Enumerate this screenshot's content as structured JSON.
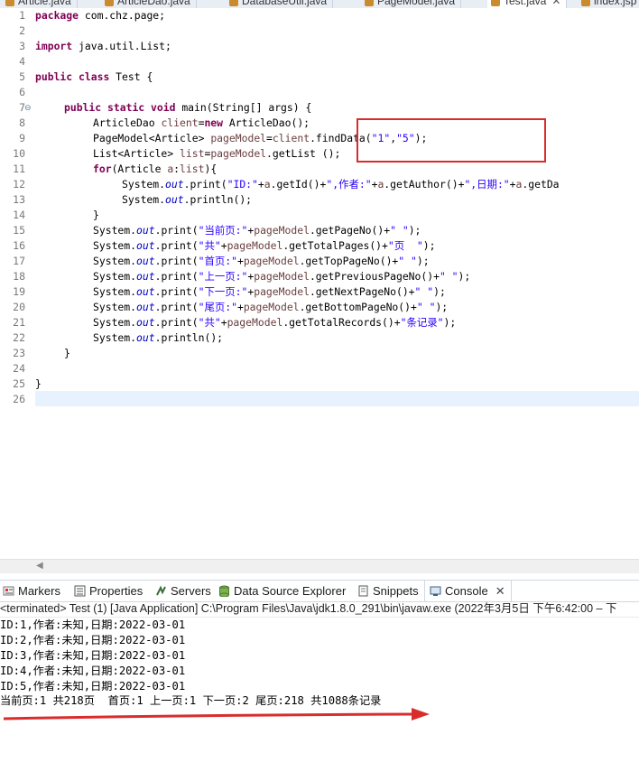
{
  "editor_tabs": [
    {
      "label": "Article.java",
      "active": false
    },
    {
      "label": "ArticleDao.java",
      "active": false
    },
    {
      "label": "DatabaseUtil.java",
      "active": false
    },
    {
      "label": "PageModel.java",
      "active": false
    },
    {
      "label": "Test.java",
      "active": true
    },
    {
      "label": "index.jsp",
      "active": false
    }
  ],
  "line_numbers": [
    "1",
    "2",
    "3",
    "4",
    "5",
    "6",
    "7",
    "8",
    "9",
    "10",
    "11",
    "12",
    "13",
    "14",
    "15",
    "16",
    "17",
    "18",
    "19",
    "20",
    "21",
    "22",
    "23",
    "24",
    "25",
    "26"
  ],
  "code": {
    "l1_kw": "package",
    "l1_rest": " com.chz.page;",
    "l3_kw": "import",
    "l3_rest": " java.util.List;",
    "l5_kw1": "public",
    "l5_kw2": "class",
    "l5_rest": " Test {",
    "l7_kw1": "public",
    "l7_kw2": "static",
    "l7_kw3": "void",
    "l7_rest": " main(String[] args) {",
    "l8_a": "ArticleDao ",
    "l8_var": "client",
    "l8_b": "=",
    "l8_kw": "new",
    "l8_c": " ArticleDao();",
    "l9_a": "PageModel<Article> ",
    "l9_var": "pageModel",
    "l9_b": "=",
    "l9_var2": "client",
    "l9_c": ".findData(",
    "l9_s1": "\"1\"",
    "l9_d": ",",
    "l9_s2": "\"5\"",
    "l9_e": ");",
    "l10_a": "List<Article> ",
    "l10_var": "list",
    "l10_b": "=",
    "l10_var2": "pageModel",
    "l10_c": ".getList ();",
    "l11_kw": "for",
    "l11_a": "(Article ",
    "l11_var": "a",
    "l11_b": ":",
    "l11_var2": "list",
    "l11_c": "){",
    "l12_a": "System.",
    "l12_fld": "out",
    "l12_b": ".print(",
    "l12_s1": "\"ID:\"",
    "l12_c": "+",
    "l12_v1": "a",
    "l12_d": ".getId()+",
    "l12_s2": "\",作者:\"",
    "l12_e": "+",
    "l12_v2": "a",
    "l12_f": ".getAuthor()+",
    "l12_s3": "\",日期:\"",
    "l12_g": "+",
    "l12_v3": "a",
    "l12_h": ".getDa",
    "l13_a": "System.",
    "l13_fld": "out",
    "l13_b": ".println();",
    "l14": "}",
    "l15_a": "System.",
    "l15_fld": "out",
    "l15_b": ".print(",
    "l15_s1": "\"当前页:\"",
    "l15_c": "+",
    "l15_var": "pageModel",
    "l15_d": ".getPageNo()+",
    "l15_s2": "\" \"",
    "l15_e": ");",
    "l16_a": "System.",
    "l16_fld": "out",
    "l16_b": ".print(",
    "l16_s1": "\"共\"",
    "l16_c": "+",
    "l16_var": "pageModel",
    "l16_d": ".getTotalPages()+",
    "l16_s2": "\"页  \"",
    "l16_e": ");",
    "l17_a": "System.",
    "l17_fld": "out",
    "l17_b": ".print(",
    "l17_s1": "\"首页:\"",
    "l17_c": "+",
    "l17_var": "pageModel",
    "l17_d": ".getTopPageNo()+",
    "l17_s2": "\" \"",
    "l17_e": ");",
    "l18_a": "System.",
    "l18_fld": "out",
    "l18_b": ".print(",
    "l18_s1": "\"上一页:\"",
    "l18_c": "+",
    "l18_var": "pageModel",
    "l18_d": ".getPreviousPageNo()+",
    "l18_s2": "\" \"",
    "l18_e": ");",
    "l19_a": "System.",
    "l19_fld": "out",
    "l19_b": ".print(",
    "l19_s1": "\"下一页:\"",
    "l19_c": "+",
    "l19_var": "pageModel",
    "l19_d": ".getNextPageNo()+",
    "l19_s2": "\" \"",
    "l19_e": ");",
    "l20_a": "System.",
    "l20_fld": "out",
    "l20_b": ".print(",
    "l20_s1": "\"尾页:\"",
    "l20_c": "+",
    "l20_var": "pageModel",
    "l20_d": ".getBottomPageNo()+",
    "l20_s2": "\" \"",
    "l20_e": ");",
    "l21_a": "System.",
    "l21_fld": "out",
    "l21_b": ".print(",
    "l21_s1": "\"共\"",
    "l21_c": "+",
    "l21_var": "pageModel",
    "l21_d": ".getTotalRecords()+",
    "l21_s2": "\"条记录\"",
    "l21_e": ");",
    "l22_a": "System.",
    "l22_fld": "out",
    "l22_b": ".println();",
    "l23": "}",
    "l25": "}"
  },
  "view_tabs": {
    "markers": "Markers",
    "properties": "Properties",
    "servers": "Servers",
    "data_source": "Data Source Explorer",
    "snippets": "Snippets",
    "console": "Console"
  },
  "console": {
    "header": "<terminated> Test (1) [Java Application] C:\\Program Files\\Java\\jdk1.8.0_291\\bin\\javaw.exe  (2022年3月5日 下午6:42:00 – 下",
    "lines": [
      "ID:1,作者:未知,日期:2022-03-01",
      "ID:2,作者:未知,日期:2022-03-01",
      "ID:3,作者:未知,日期:2022-03-01",
      "ID:4,作者:未知,日期:2022-03-01",
      "ID:5,作者:未知,日期:2022-03-01",
      "当前页:1 共218页  首页:1 上一页:1 下一页:2 尾页:218 共1088条记录"
    ]
  },
  "colors": {
    "keyword": "#7f0055",
    "string": "#2a00ff",
    "field": "#0000c0",
    "annotation_red": "#d92d2d"
  },
  "icons": {
    "close": "close-icon",
    "fold": "collapse-toggle-icon"
  }
}
